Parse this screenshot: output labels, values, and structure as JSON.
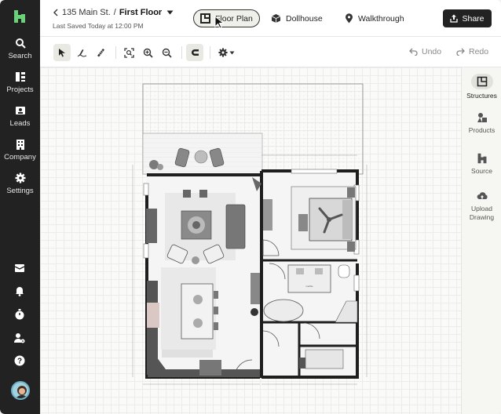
{
  "nav": {
    "items": [
      {
        "label": "Search",
        "icon": "search-icon"
      },
      {
        "label": "Projects",
        "icon": "projects-icon"
      },
      {
        "label": "Leads",
        "icon": "leads-icon"
      },
      {
        "label": "Company",
        "icon": "company-icon"
      },
      {
        "label": "Settings",
        "icon": "settings-icon"
      }
    ],
    "bottom_icons": [
      "mail-icon",
      "bell-icon",
      "timer-icon",
      "user-settings-icon",
      "help-icon"
    ]
  },
  "header": {
    "breadcrumb_parent": "135 Main St.",
    "breadcrumb_separator": "/",
    "breadcrumb_current": "First Floor",
    "last_saved": "Last Saved Today at 12:00 PM",
    "view_tabs": [
      {
        "label": "Floor Plan",
        "active": true
      },
      {
        "label": "Dollhouse",
        "active": false
      },
      {
        "label": "Walkthrough",
        "active": false
      }
    ],
    "share_label": "Share"
  },
  "toolbar": {
    "undo_label": "Undo",
    "redo_label": "Redo"
  },
  "right_panel": {
    "items": [
      {
        "label": "Structures",
        "active": true
      },
      {
        "label": "Products",
        "active": false
      },
      {
        "label": "Source",
        "active": false
      },
      {
        "label": "Upload Drawing",
        "active": false
      }
    ]
  },
  "colors": {
    "nav_bg": "#222222",
    "accent": "#222222",
    "wall": "#1e1e1e"
  }
}
